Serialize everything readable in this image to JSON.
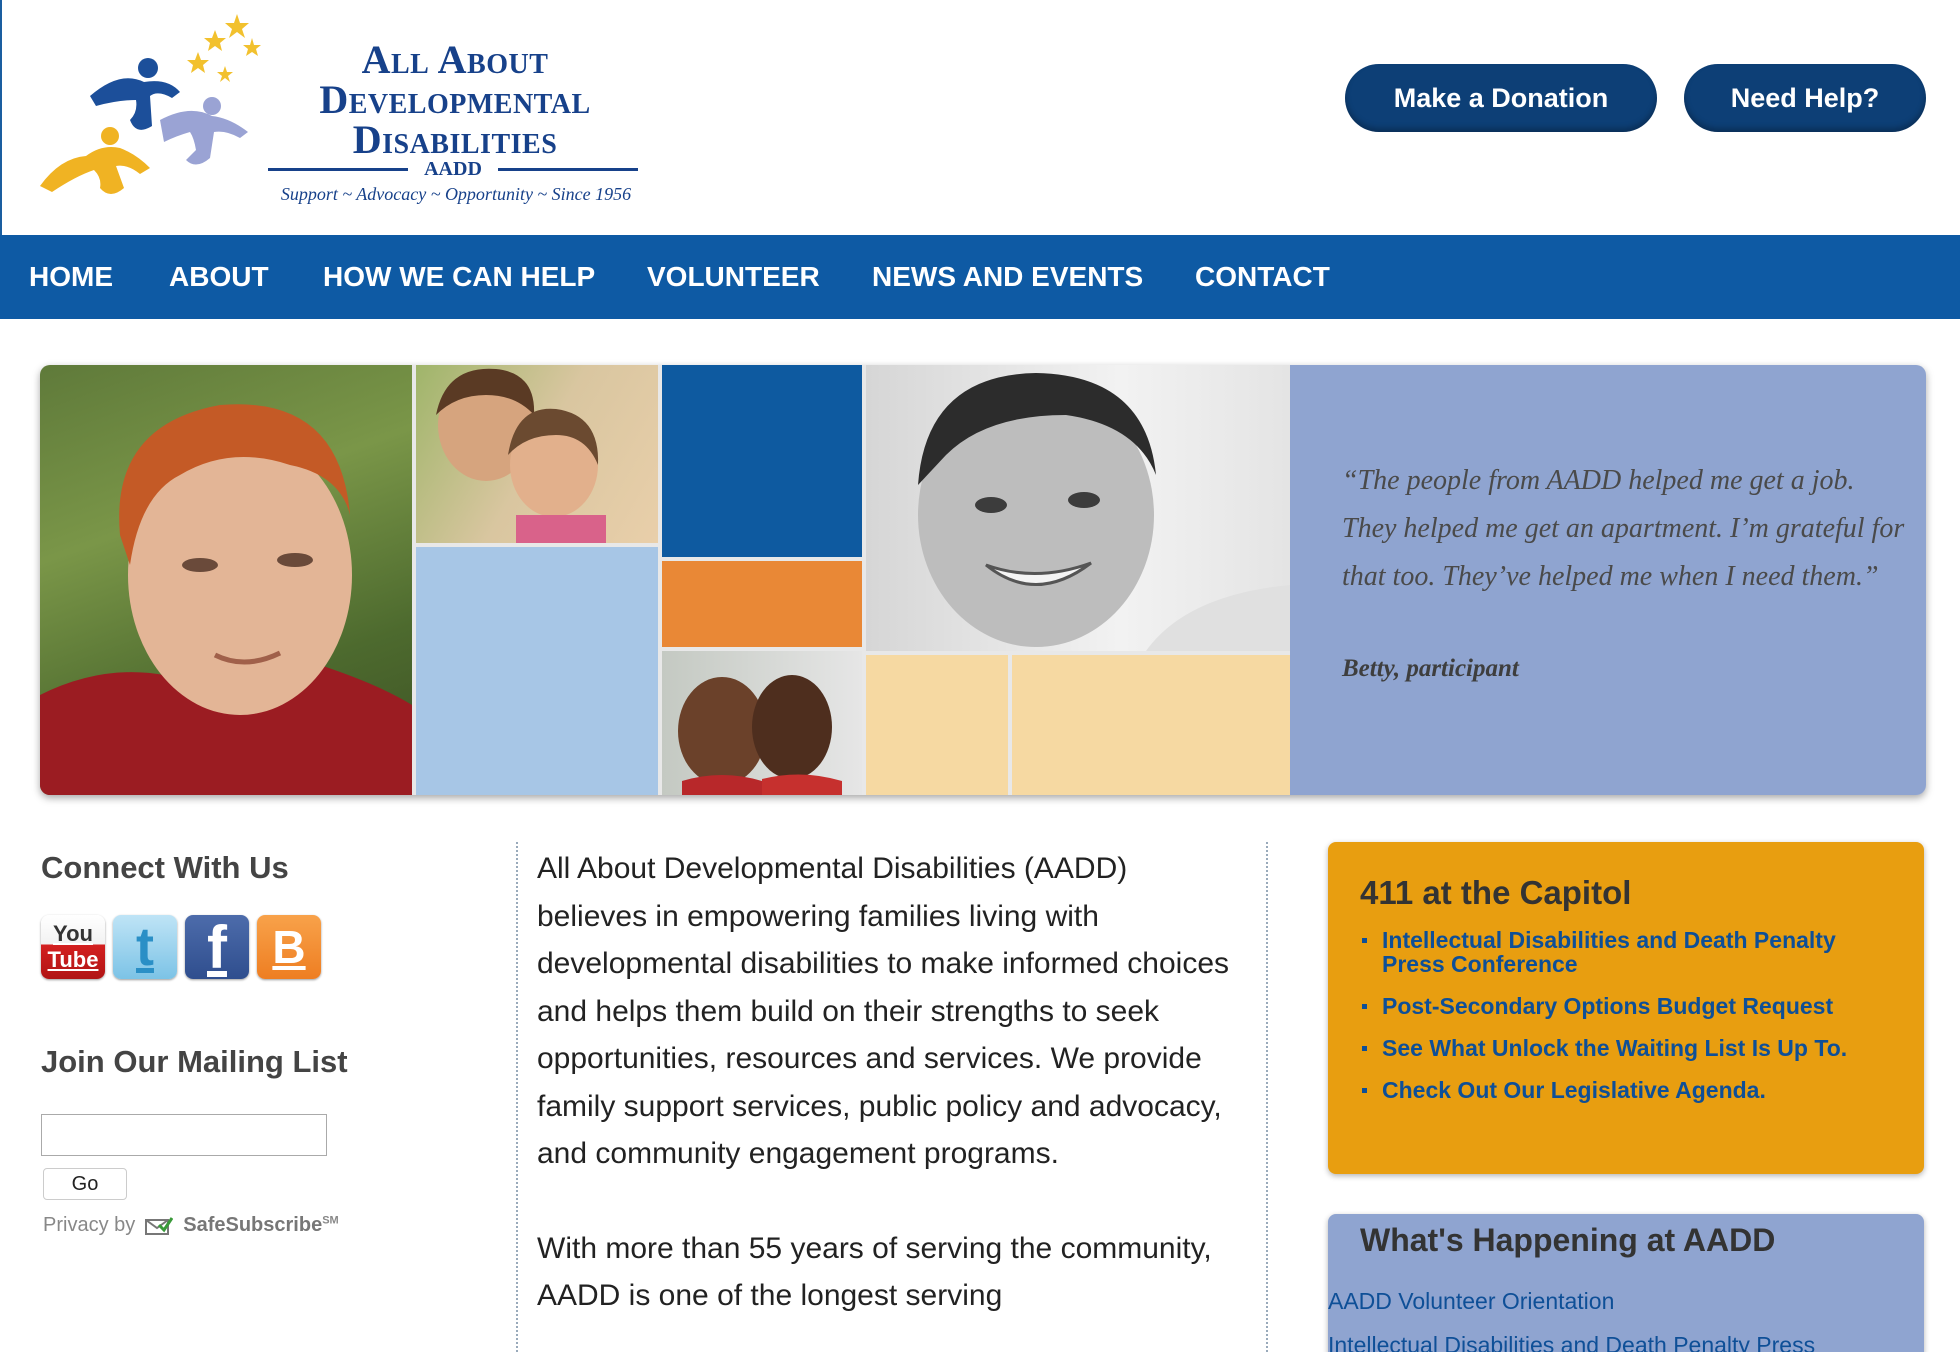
{
  "logo": {
    "line1": "All About",
    "line2": "Developmental",
    "line3": "Disabilities",
    "abbr": "AADD",
    "tagline": "Support ~ Advocacy ~ Opportunity ~ Since 1956"
  },
  "header": {
    "donate_label": "Make a Donation",
    "help_label": "Need Help?"
  },
  "nav": {
    "items": [
      {
        "label": "HOME"
      },
      {
        "label": "ABOUT"
      },
      {
        "label": "HOW WE CAN HELP"
      },
      {
        "label": "VOLUNTEER"
      },
      {
        "label": "NEWS AND EVENTS"
      },
      {
        "label": "CONTACT"
      }
    ]
  },
  "hero": {
    "quote": "“The people from AADD helped me get a job. They helped me get an apartment. I’m grateful for that too. They’ve helped me when I need them.”",
    "attribution": "Betty, participant",
    "colors": {
      "blue": "#0e5aa0",
      "light_blue": "#a7c6e6",
      "orange": "#e98836",
      "peach": "#f6d9a2",
      "quote_panel": "#8fa4d0"
    }
  },
  "sidebar": {
    "connect_title": "Connect With Us",
    "social": [
      {
        "name": "youtube-icon",
        "label_top": "You",
        "label_bottom": "Tube"
      },
      {
        "name": "twitter-icon",
        "label": "t"
      },
      {
        "name": "facebook-icon",
        "label": "f"
      },
      {
        "name": "blogger-icon",
        "label": "B"
      }
    ],
    "mailing_title": "Join Our Mailing List",
    "mailing_input_value": "",
    "go_label": "Go",
    "privacy_prefix": "Privacy by",
    "privacy_brand": "SafeSubscribe",
    "privacy_sm": "SM"
  },
  "main": {
    "paragraph1": "All About Developmental Disabilities (AADD) believes in empowering families living with developmental disabilities to make informed choices and helps them build on their strengths to seek opportunities, resources and services. We provide family support services, public policy and advocacy, and community engagement programs.",
    "paragraph2": "With more than 55 years of serving the community, AADD is one of the longest serving"
  },
  "box411": {
    "title": "411 at the Capitol",
    "links": [
      "Intellectual Disabilities and Death Penalty Press Conference",
      "Post-Secondary Options Budget Request",
      "See What Unlock the Waiting List Is Up To.",
      "Check Out Our Legislative Agenda."
    ]
  },
  "happening": {
    "title": "What's Happening at AADD",
    "links": [
      "AADD Volunteer Orientation",
      "Intellectual Disabilities and Death Penalty Press"
    ]
  }
}
